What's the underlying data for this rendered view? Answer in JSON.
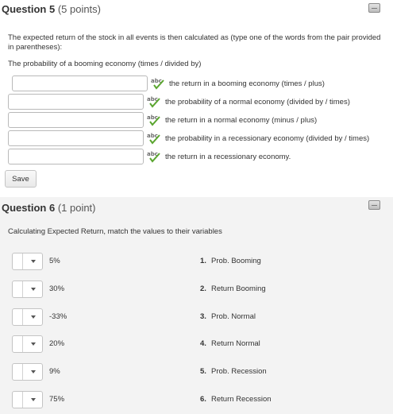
{
  "q5": {
    "title": "Question 5",
    "points": "(5 points)",
    "prompt": "The expected return of the stock in all events is then calculated as (type one of the words from the pair provided in parentheses):",
    "line1": "The probability of a booming economy (times / divided by)",
    "segments": [
      {
        "text": "the return in a booming economy (times / plus)",
        "value": ""
      },
      {
        "text": "the probability of a normal economy (divided by / times)",
        "value": ""
      },
      {
        "text": "the return in a normal economy (minus / plus)",
        "value": ""
      },
      {
        "text": "the probability in a recessionary economy (divided by / times)",
        "value": ""
      },
      {
        "text": "the return in a recessionary economy.",
        "value": ""
      }
    ],
    "save_label": "Save"
  },
  "q6": {
    "title": "Question 6",
    "points": "(1 point)",
    "prompt": "Calculating Expected Return, match the values to their variables",
    "values": [
      "5%",
      "30%",
      "-33%",
      "20%",
      "9%",
      "75%"
    ],
    "variables": [
      {
        "num": "1.",
        "label": "Prob. Booming"
      },
      {
        "num": "2.",
        "label": "Return Booming"
      },
      {
        "num": "3.",
        "label": "Prob. Normal"
      },
      {
        "num": "4.",
        "label": "Return Normal"
      },
      {
        "num": "5.",
        "label": "Prob. Recession"
      },
      {
        "num": "6.",
        "label": "Return Recession"
      }
    ]
  },
  "colors": {
    "check": "#5aa52f",
    "abc_text": "#6b6b6b"
  },
  "icons": {
    "spell": "spellcheck-icon",
    "flag": "bookmark-flag-icon",
    "dropdown": "chevron-down-icon"
  }
}
